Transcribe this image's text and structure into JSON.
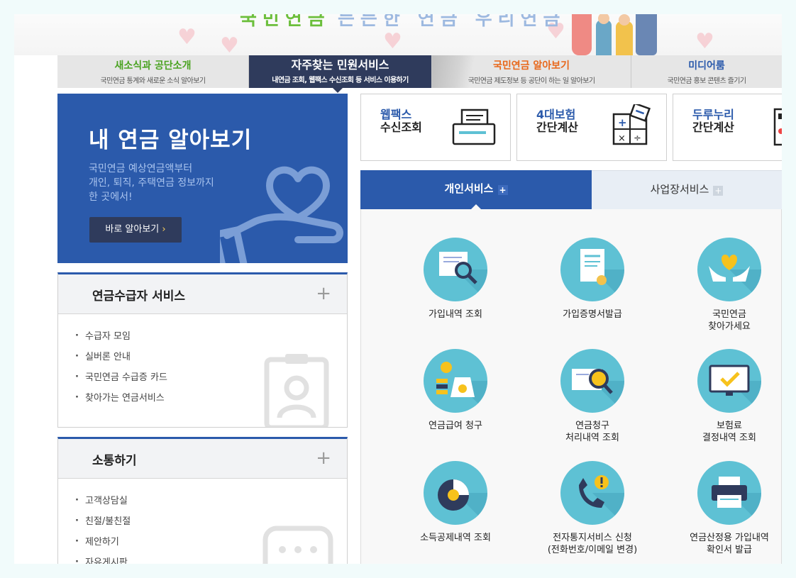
{
  "banner": {
    "headline_fragment": "국민연금",
    "tagline_fragment": "든든한 연금 우리연금"
  },
  "nav": [
    {
      "title": "새소식과 공단소개",
      "subtitle": "국민연금 통계와 새로운 소식 알아보기",
      "color": "#4aa321"
    },
    {
      "title": "자주찾는 민원서비스",
      "subtitle": "내연금 조회, 웹팩스 수신조회 등 서비스 이용하기",
      "color": "#ffffff"
    },
    {
      "title": "국민연금 알아보기",
      "subtitle": "국민연금 제도정보 등 공단이 하는 일 알아보기",
      "color": "#e8671a"
    },
    {
      "title": "미디어룸",
      "subtitle": "국민연금 홍보 콘텐츠 즐기기",
      "color": "#2b5aab"
    }
  ],
  "hero": {
    "title": "내 연금 알아보기",
    "desc": [
      "국민연금 예상연금액부터",
      "개인, 퇴직, 주택연금 정보까지",
      "한 곳에서!"
    ],
    "button": "바로 알아보기",
    "button_arrow": "›"
  },
  "pension_box": {
    "title": "연금수급자 서비스",
    "plus": "+",
    "items": [
      "수급자 모임",
      "실버론 안내",
      "국민연금 수급증 카드",
      "찾아가는 연금서비스"
    ]
  },
  "comm_box": {
    "title": "소통하기",
    "plus": "+",
    "items": [
      "고객상담실",
      "친절/불친절",
      "제안하기",
      "자유게시판"
    ]
  },
  "quick_cards": [
    {
      "lines": [
        "웹팩스",
        "수신조회"
      ],
      "icon": "fax-icon"
    },
    {
      "lines": [
        "4대보험",
        "간단계산"
      ],
      "icon": "calculator-icon"
    },
    {
      "lines": [
        "두루누리",
        "간단계산"
      ],
      "icon": "calculator-icon"
    }
  ],
  "service_tabs": [
    {
      "label": "개인서비스",
      "plus": "+"
    },
    {
      "label": "사업장서비스",
      "plus": "+"
    }
  ],
  "services": [
    {
      "lines": [
        "가입내역 조회"
      ],
      "icon": "document-search-icon"
    },
    {
      "lines": [
        "가입증명서발급"
      ],
      "icon": "certificate-icon"
    },
    {
      "lines": [
        "국민연금",
        "찾아가세요"
      ],
      "icon": "heart-hands-icon"
    },
    {
      "lines": [
        "연금급여 청구"
      ],
      "icon": "money-bag-icon"
    },
    {
      "lines": [
        "연금청구",
        "처리내역 조회"
      ],
      "icon": "money-search-icon"
    },
    {
      "lines": [
        "보험료",
        "결정내역 조회"
      ],
      "icon": "monitor-check-icon"
    },
    {
      "lines": [
        "소득공제내역 조회"
      ],
      "icon": "pie-chart-icon"
    },
    {
      "lines": [
        "전자통지서비스 신청",
        "(전화번호/이메일 변경)"
      ],
      "icon": "phone-alert-icon"
    },
    {
      "lines": [
        "연금산정용 가입내역",
        "확인서 발급"
      ],
      "icon": "printer-icon"
    }
  ],
  "colors": {
    "primary": "#2b5aab",
    "nav_active": "#2f3b5c",
    "icon_circle": "#5ec1d4",
    "accent_yellow": "#ffd25c"
  }
}
